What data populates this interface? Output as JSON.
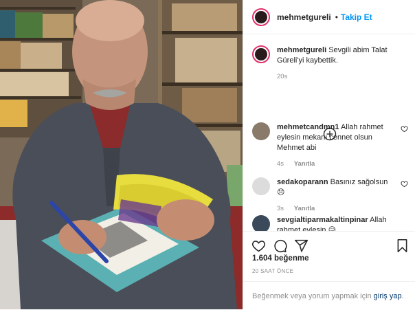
{
  "header": {
    "username": "mehmetgureli",
    "dot": "•",
    "follow_label": "Takip Et"
  },
  "caption": {
    "username": "mehmetgureli",
    "text": "Sevgili abim Talat Güreli'yi kaybettik.",
    "time": "20s"
  },
  "comments": [
    {
      "username": "mehmetcandmn1",
      "text": "Allah rahmet eylesin mekanı cennet olsun Mehmet abi",
      "time": "4s",
      "reply_label": "Yanıtla"
    },
    {
      "username": "sedakoparann",
      "text": "Basınız sağolsun 😞",
      "time": "3s",
      "reply_label": "Yanıtla"
    },
    {
      "username": "sevgialtiparmakaltinpinar",
      "text": "Allah rahmet eylesin 😥",
      "time": "",
      "reply_label": ""
    }
  ],
  "actions": {
    "likes": "1.604 beğenme",
    "time_ago": "20 SAAT ÖNCE",
    "login_prompt": "Beğenmek veya yorum yapmak için",
    "login_link": "giriş yap",
    "login_end": "."
  },
  "icons": [
    "heart-icon",
    "comment-icon",
    "share-icon",
    "bookmark-icon",
    "plus-circle-icon"
  ],
  "colors": {
    "link": "#0095f6",
    "text": "#262626",
    "muted": "#8e8e8e",
    "story_ring": "#e1306c"
  }
}
